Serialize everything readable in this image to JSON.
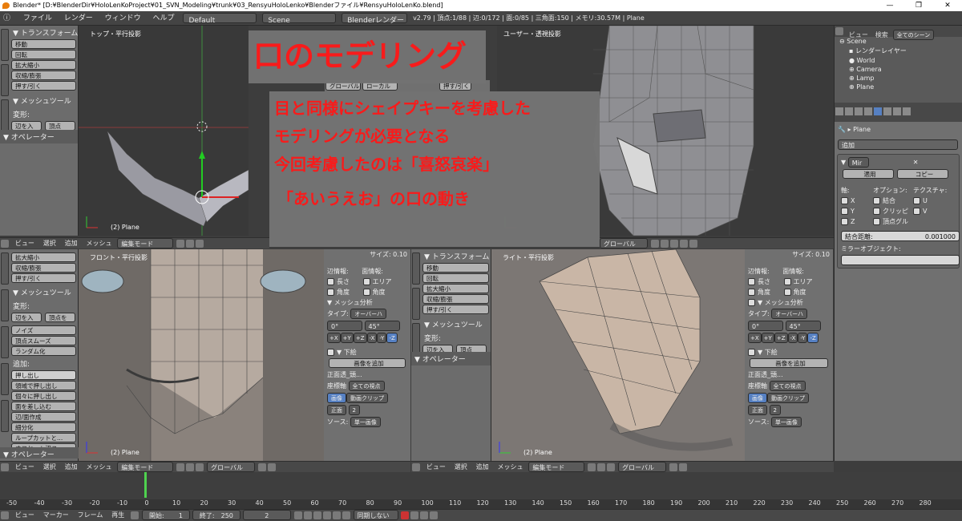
{
  "window": {
    "title": "Blender* [D:¥BlenderDir¥HoloLenKoProject¥01_SVN_Modeling¥trunk¥03_RensyuHoloLenko¥Blenderファイル¥RensyuHoloLenKo.blend]",
    "min": "—",
    "max": "❐",
    "close": "✕"
  },
  "menu": {
    "items": [
      "ファイル",
      "レンダー",
      "ウィンドウ",
      "ヘルプ"
    ],
    "layout": "Default",
    "scene": "Scene",
    "engine": "Blenderレンダー",
    "stats": "v2.79 | 頂点:1/88 | 辺:0/172 | 面:0/85 | 三角面:150 | メモリ:30.57M | Plane"
  },
  "tools_panel_top": {
    "section_transform": "▼ トランスフォーム",
    "transform_buttons": [
      "移動",
      "回転",
      "拡大縮小",
      "収縮/膨張",
      "押す/引く"
    ],
    "section_mesh": "▼ メッシュツール",
    "deform_label": "変形:",
    "deform_buttons": [
      "辺を入",
      "頂点"
    ],
    "section_operator": "▼ オペレーター"
  },
  "viewport_top": {
    "label": "トップ・平行投影",
    "object_name": "(2) Plane"
  },
  "viewport_user": {
    "label": "ユーザー・透視投影"
  },
  "overlay_panel_top": {
    "global": "グローバル",
    "local": "ローカル",
    "push": "押す/引く"
  },
  "slide": {
    "title": "口のモデリング",
    "lines": [
      "目と同様にシェイプキーを考慮した",
      "モデリングが必要となる",
      "今回考慮したのは「喜怒哀楽」",
      "「あいうえお」の口の動き"
    ]
  },
  "header_top": {
    "items": [
      "ビュー",
      "選択",
      "追加",
      "メッシュ"
    ],
    "mode": "編集モード",
    "orientation": "グローバル"
  },
  "tools_panel_bottom": {
    "buttons_top": [
      "拡大縮小",
      "収縮/膨張",
      "押す/引く"
    ],
    "section_mesh": "▼ メッシュツール",
    "deform_label": "変形:",
    "deform_buttons": [
      "辺を入",
      "頂点を"
    ],
    "deform_list": [
      "ノイズ",
      "頂点スムーズ",
      "ランダム化"
    ],
    "add_label": "追加:",
    "add_buttons": [
      "押し出し",
      "領域で押し出し",
      "個々に押し出し",
      "面を差し込む",
      "辺/面作成",
      "細分化",
      "ループカットと...",
      "オフセット辺ス..."
    ],
    "section_operator": "▼ オペレーター"
  },
  "viewport_front": {
    "label": "フロント・平行投影",
    "object_name": "(2) Plane"
  },
  "viewport_right": {
    "label": "ライト・平行投影",
    "object_name": "(2) Plane"
  },
  "props_mid": {
    "size_label": "サイズ: 0.10",
    "edge_info": "辺情報:",
    "face_info": "面情報:",
    "length": "長さ",
    "area": "エリア",
    "angle": "角度",
    "angle2": "角度",
    "mesh_analysis": "▼ メッシュ分析",
    "type_label": "タイプ:",
    "type_value": "オーバーハ",
    "deg0": "0°",
    "deg45": "45°",
    "axes": [
      "+X",
      "+Y",
      "+Z",
      "-X",
      "-Y",
      "-Z"
    ],
    "background": "▼ 下絵",
    "add_image": "画像を追加",
    "image_name": "正面透_頭...",
    "axis_label": "座標軸",
    "axis_value": "全ての視点",
    "image": "画像",
    "movie": "動画クリップ",
    "front": "正面",
    "num": "2",
    "source_label": "ソース:",
    "source_value": "単一画像"
  },
  "tools_panel_right": {
    "section_transform": "▼ トランスフォーム",
    "transform_buttons": [
      "移動",
      "回転",
      "拡大縮小",
      "収縮/膨張",
      "押す/引く"
    ],
    "section_mesh": "▼ メッシュツール",
    "deform_label": "変形:",
    "deform_buttons": [
      "辺を入",
      "頂点"
    ],
    "section_operator": "▼ オペレーター"
  },
  "props_right": {
    "size_label": "サイズ: 0.10",
    "edge_info": "辺情報:",
    "face_info": "面情報:",
    "length": "長さ",
    "area": "エリア",
    "angle": "角度",
    "angle2": "角度",
    "mesh_analysis": "▼ メッシュ分析",
    "type_label": "タイプ:",
    "type_value": "オーバーハ",
    "deg0": "0°",
    "deg45": "45°",
    "background": "▼ 下絵",
    "add_image": "画像を追加",
    "image_name": "正面透_頭...",
    "axis_label": "座標軸",
    "axis_value": "全ての視点",
    "image": "画像",
    "movie": "動画クリップ",
    "front": "正面",
    "num": "2",
    "source_label": "ソース:",
    "source_value": "単一画像"
  },
  "outliner": {
    "tabs": [
      "ビュー",
      "検索",
      "全てのシーン"
    ],
    "items": [
      "Scene",
      "レンダーレイヤー",
      "World",
      "Camera",
      "Lamp",
      "Plane"
    ]
  },
  "properties": {
    "object": "Plane",
    "add_modifier": "追加",
    "modifier_name": "Mir",
    "apply": "適用",
    "copy": "コピー",
    "axis_label": "軸:",
    "options_label": "オプション:",
    "texture_label": "テクスチャ:",
    "x": "X",
    "y": "Y",
    "z": "Z",
    "merge": "結合",
    "clipping": "クリッピ",
    "vertex_group": "頂点グル",
    "u": "U",
    "v": "V",
    "merge_distance_label": "結合距離:",
    "merge_distance": "0.001000",
    "mirror_object_label": "ミラーオブジェクト:"
  },
  "timeline": {
    "ticks": [
      "-50",
      "-40",
      "-30",
      "-20",
      "-10",
      "0",
      "10",
      "20",
      "30",
      "40",
      "50",
      "60",
      "70",
      "80",
      "90",
      "100",
      "110",
      "120",
      "130",
      "140",
      "150",
      "160",
      "170",
      "180",
      "190",
      "200",
      "210",
      "220",
      "230",
      "240",
      "250",
      "260",
      "270",
      "280"
    ],
    "current_frame": 2,
    "menu": [
      "ビュー",
      "マーカー",
      "フレーム",
      "再生"
    ],
    "start_label": "開始:",
    "start": "1",
    "end_label": "終了:",
    "end": "250",
    "frame": "2",
    "sync": "同期しない"
  }
}
